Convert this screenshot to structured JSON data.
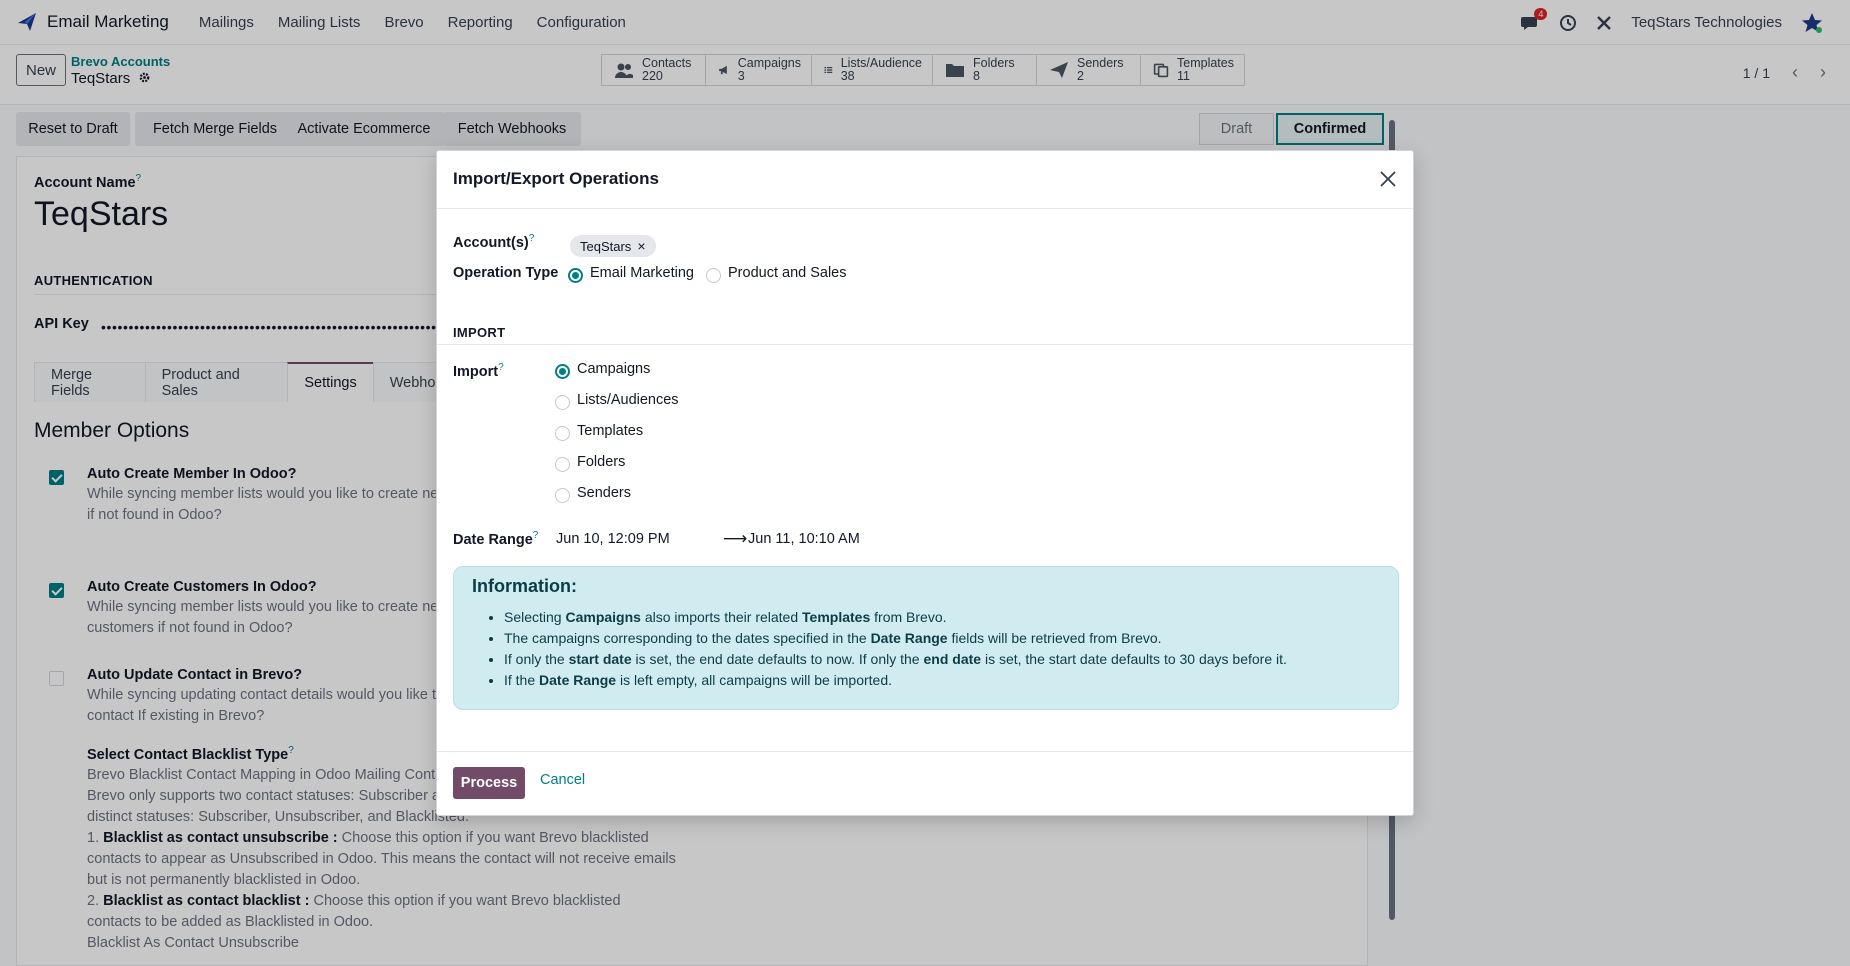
{
  "navbar": {
    "app_name": "Email Marketing",
    "menus": [
      "Mailings",
      "Mailing Lists",
      "Brevo",
      "Reporting",
      "Configuration"
    ],
    "chat_badge": "4",
    "company": "TeqStars Technologies"
  },
  "control": {
    "new_label": "New",
    "breadcrumb_parent": "Brevo Accounts",
    "breadcrumb_current": "TeqStars",
    "stats": [
      {
        "icon": "users-icon",
        "label": "Contacts",
        "value": "220"
      },
      {
        "icon": "megaphone-icon",
        "label": "Campaigns",
        "value": "3"
      },
      {
        "icon": "list-icon",
        "label": "Lists/Audience",
        "value": "38"
      },
      {
        "icon": "folder-icon",
        "label": "Folders",
        "value": "8"
      },
      {
        "icon": "paper-plane-icon",
        "label": "Senders",
        "value": "2"
      },
      {
        "icon": "copy-icon",
        "label": "Templates",
        "value": "11"
      }
    ],
    "pager": "1 / 1"
  },
  "actions": {
    "reset": "Reset to Draft",
    "fetch_merge": "Fetch Merge Fields",
    "activate": "Activate Ecommerce",
    "fetch_webhooks": "Fetch Webhooks"
  },
  "stages": {
    "draft": "Draft",
    "confirmed": "Confirmed"
  },
  "form": {
    "account_name_label": "Account Name",
    "account_name": "TeqStars",
    "auth_section": "AUTHENTICATION",
    "api_key_label": "API Key",
    "api_key_mask": "••••••••••••••••••••••••••••••••••••••••••••••••••••••••••••••••••••••••••••••••••••••••",
    "tabs": [
      "Merge Fields",
      "Product and Sales",
      "Settings",
      "Webhooks"
    ],
    "member_options_title": "Member Options",
    "options": [
      {
        "title": "Auto Create Member In Odoo?",
        "desc": "While syncing member lists would you like to create new member if not found in Odoo?",
        "checked": true
      },
      {
        "title": "Auto Create Customers In Odoo?",
        "desc": "While syncing member lists would you like to create new customers if not found in Odoo?",
        "checked": true
      },
      {
        "title": "Auto Update Contact in Brevo?",
        "desc": "While syncing updating contact details would you like to update the contact If existing in Brevo?",
        "checked": false
      }
    ],
    "blacklist_title": "Select Contact Blacklist Type",
    "blacklist_desc1": "Brevo Blacklist Contact Mapping in Odoo Mailing Contacts:",
    "blacklist_desc2": "Brevo only supports two contact statuses: Subscriber and Blacklisted. Odoo has three",
    "blacklist_desc3": "distinct statuses: Subscriber, Unsubscriber, and Blacklisted.",
    "blacklist_opt1_bold": "Blacklist as contact unsubscribe :",
    "blacklist_opt1_text": "Choose this option if you want Brevo blacklisted contacts to appear as Unsubscribed in Odoo. This means the contact will not receive emails but is not permanently blacklisted in Odoo.",
    "blacklist_opt2_bold": "Blacklist as contact blacklist :",
    "blacklist_opt2_text": "Choose this option if you want Brevo blacklisted contacts to be added as Blacklisted in Odoo.",
    "blacklist_value": "Blacklist As Contact Unsubscribe"
  },
  "modal": {
    "title": "Import/Export Operations",
    "accounts_label": "Account(s)",
    "account_tag": "TeqStars",
    "operation_type_label": "Operation Type",
    "operation_types": [
      "Email Marketing",
      "Product and Sales"
    ],
    "selected_operation": "Email Marketing",
    "import_section": "IMPORT",
    "import_label": "Import",
    "import_options": [
      "Campaigns",
      "Lists/Audiences",
      "Templates",
      "Folders",
      "Senders"
    ],
    "selected_import": "Campaigns",
    "date_range_label": "Date Range",
    "date_start": "Jun 10, 12:09 PM",
    "date_end": "Jun 11, 10:10 AM",
    "info_title": "Information:",
    "info": {
      "l1_a": "Selecting ",
      "l1_b": "Campaigns",
      "l1_c": " also imports their related ",
      "l1_d": "Templates",
      "l1_e": " from Brevo.",
      "l2_a": "The campaigns corresponding to the dates specified in the ",
      "l2_b": "Date Range",
      "l2_c": " fields will be retrieved from Brevo.",
      "l3_a": "If only the ",
      "l3_b": "start date",
      "l3_c": " is set, the end date defaults to now. If only the ",
      "l3_d": "end date",
      "l3_e": " is set, the start date defaults to 30 days before it.",
      "l4_a": "If the ",
      "l4_b": "Date Range",
      "l4_c": " is left empty, all campaigns will be imported."
    },
    "process_label": "Process",
    "cancel_label": "Cancel"
  },
  "colors": {
    "primary": "#714b67",
    "accent": "#017e84",
    "info_bg": "#d1ecf1"
  }
}
